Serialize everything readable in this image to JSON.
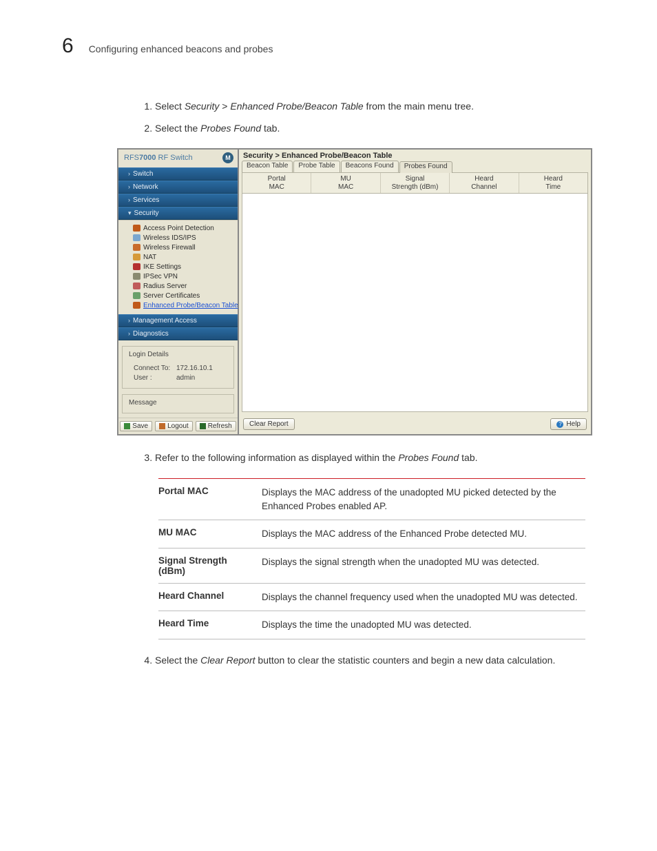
{
  "page": {
    "chapter": "6",
    "section_title": "Configuring enhanced beacons and probes"
  },
  "steps_a": {
    "s1_pre": "Select ",
    "s1_em1": "Security",
    "s1_mid1": " > ",
    "s1_em2": "Enhanced Probe/Beacon Table",
    "s1_post": " from the main menu tree.",
    "s2_pre": "Select the ",
    "s2_em": "Probes Found",
    "s2_post": " tab."
  },
  "shot": {
    "product_prefix": "RFS",
    "product_bold": "7000",
    "product_suffix": " RF Switch",
    "nav": {
      "switch": "Switch",
      "network": "Network",
      "services": "Services",
      "security": "Security",
      "mgmt": "Management Access",
      "diag": "Diagnostics"
    },
    "tree": [
      "Access Point Detection",
      "Wireless IDS/IPS",
      "Wireless Firewall",
      "NAT",
      "IKE Settings",
      "IPSec VPN",
      "Radius Server",
      "Server Certificates",
      "Enhanced Probe/Beacon Table"
    ],
    "login": {
      "legend": "Login Details",
      "connect_label": "Connect To:",
      "connect_value": "172.16.10.1",
      "user_label": "User :",
      "user_value": "admin"
    },
    "message_legend": "Message",
    "bottom_buttons": {
      "save": "Save",
      "logout": "Logout",
      "refresh": "Refresh"
    },
    "breadcrumb": "Security > Enhanced Probe/Beacon Table",
    "tabs": [
      "Beacon Table",
      "Probe Table",
      "Beacons Found",
      "Probes Found"
    ],
    "columns": [
      "Portal\nMAC",
      "MU\nMAC",
      "Signal\nStrength (dBm)",
      "Heard\nChannel",
      "Heard\nTime"
    ],
    "clear_btn": "Clear Report",
    "help_btn": "Help"
  },
  "steps_b": {
    "s3_pre": "Refer to the following information as displayed within the ",
    "s3_em": "Probes Found",
    "s3_post": " tab.",
    "s4_pre": "Select the ",
    "s4_em": "Clear Report",
    "s4_post": " button to clear the statistic counters and begin a new data calculation."
  },
  "defs": [
    {
      "k": "Portal MAC",
      "v": "Displays the MAC address of the unadopted MU picked detected by the Enhanced Probes enabled AP."
    },
    {
      "k": "MU MAC",
      "v": "Displays the MAC address of the Enhanced Probe detected MU."
    },
    {
      "k": "Signal Strength (dBm)",
      "v": "Displays the signal strength when the unadopted MU was detected."
    },
    {
      "k": "Heard Channel",
      "v": "Displays the channel frequency used when the unadopted MU was detected."
    },
    {
      "k": "Heard Time",
      "v": "Displays the time the unadopted MU was detected."
    }
  ]
}
